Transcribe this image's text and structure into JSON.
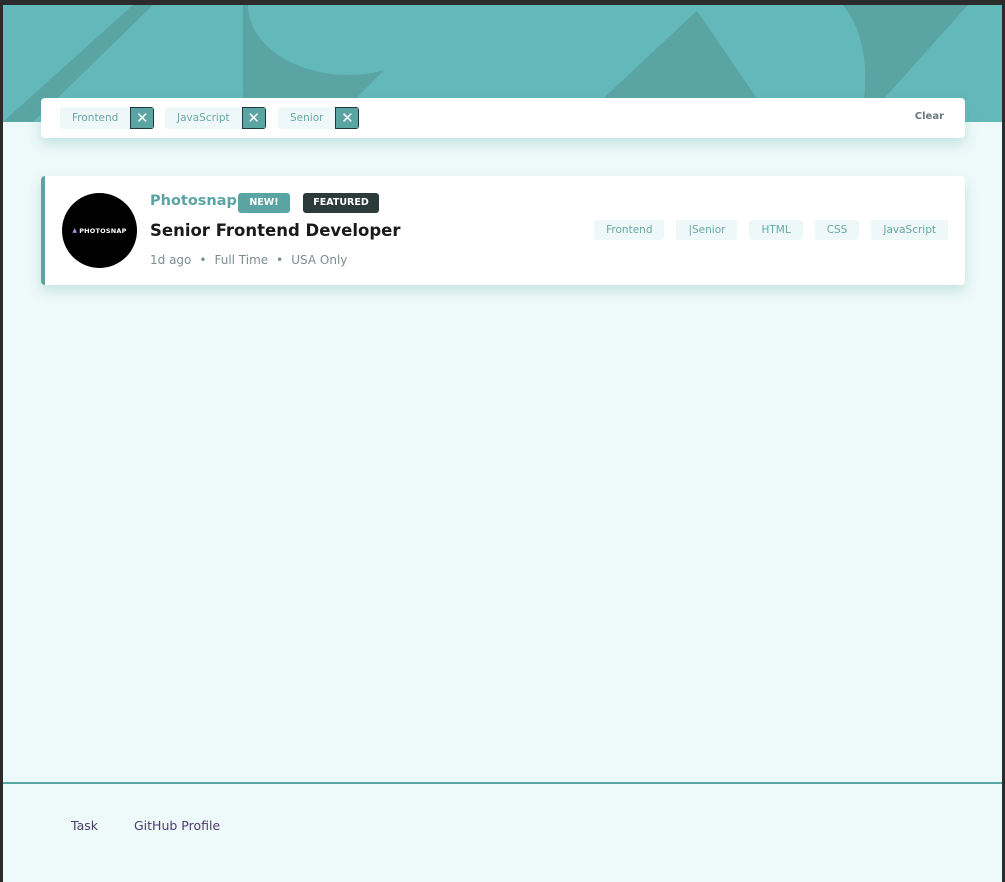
{
  "colors": {
    "accent": "#5ba4a4",
    "header_bg": "#63b9b9",
    "page_bg": "#eef9f9",
    "featured": "#2c3a3a",
    "footer_link": "#4d3a6e"
  },
  "filters": {
    "chips": [
      {
        "label": "Frontend"
      },
      {
        "label": "JavaScript"
      },
      {
        "label": "Senior"
      }
    ],
    "remove_icon": "close-icon",
    "clear_label": "Clear"
  },
  "job": {
    "logo_text": "PHOTOSNAP",
    "company": "Photosnap",
    "badge_new": "NEW!",
    "badge_featured": "FEATURED",
    "position": "Senior Frontend Developer",
    "posted": "1d ago",
    "contract": "Full Time",
    "location": "USA Only",
    "tags": [
      "Frontend",
      "|Senior",
      "HTML",
      "CSS",
      "JavaScript"
    ]
  },
  "footer": {
    "task_link": "Task",
    "github_link": "GitHub Profile"
  }
}
